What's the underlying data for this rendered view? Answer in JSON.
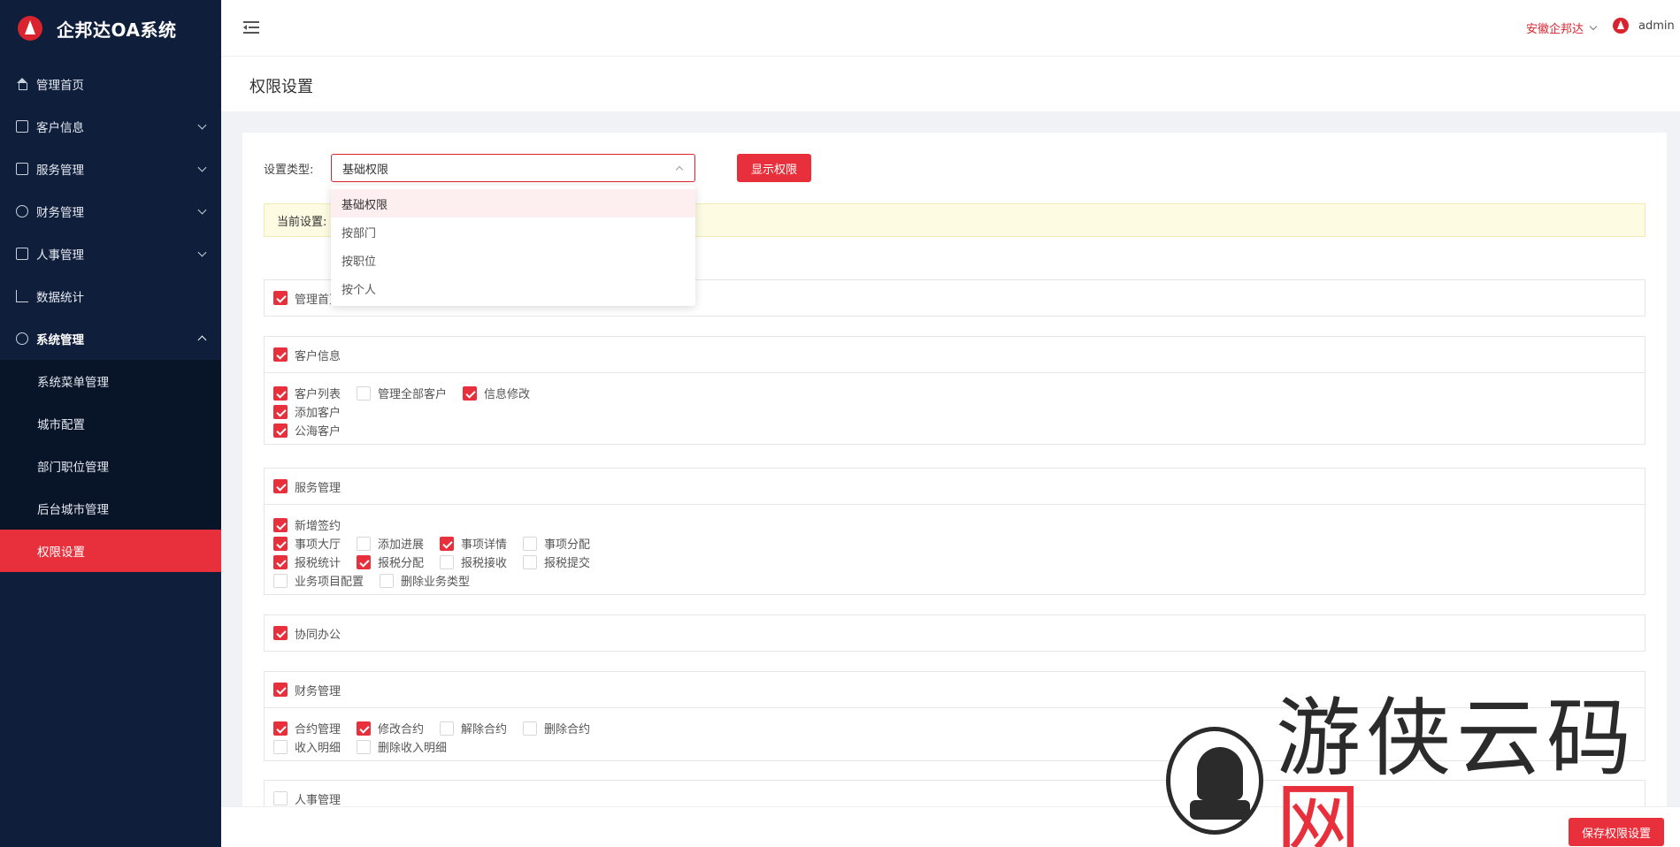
{
  "app": {
    "name": "企邦达OA系统"
  },
  "sidebar": {
    "items": [
      {
        "label": "管理首页",
        "icon": "home-icon",
        "has_children": false
      },
      {
        "label": "客户信息",
        "icon": "id-card-icon",
        "has_children": true
      },
      {
        "label": "服务管理",
        "icon": "document-icon",
        "has_children": true
      },
      {
        "label": "财务管理",
        "icon": "yen-icon",
        "has_children": true
      },
      {
        "label": "人事管理",
        "icon": "person-card-icon",
        "has_children": true
      },
      {
        "label": "数据统计",
        "icon": "chart-icon",
        "has_children": false
      },
      {
        "label": "系统管理",
        "icon": "gear-icon",
        "has_children": true,
        "expanded": true
      }
    ],
    "submenu": [
      {
        "label": "系统菜单管理",
        "active": false
      },
      {
        "label": "城市配置",
        "active": false
      },
      {
        "label": "部门职位管理",
        "active": false
      },
      {
        "label": "后台城市管理",
        "active": false
      },
      {
        "label": "权限设置",
        "active": true
      }
    ]
  },
  "header": {
    "company": "安徽企邦达",
    "username": "admin"
  },
  "page": {
    "title": "权限设置"
  },
  "form": {
    "type_label": "设置类型:",
    "type_value": "基础权限",
    "show_button": "显示权限",
    "options": [
      "基础权限",
      "按部门",
      "按职位",
      "按个人"
    ],
    "selected_option": "基础权限"
  },
  "notice": {
    "text": "当前设置:"
  },
  "groups": [
    {
      "title": "管理首页",
      "checked": true,
      "rows": []
    },
    {
      "title": "客户信息",
      "checked": true,
      "rows": [
        [
          {
            "label": "客户列表",
            "checked": true
          },
          {
            "label": "管理全部客户",
            "checked": false
          },
          {
            "label": "信息修改",
            "checked": true
          }
        ],
        [
          {
            "label": "添加客户",
            "checked": true
          }
        ],
        [
          {
            "label": "公海客户",
            "checked": true
          }
        ]
      ]
    },
    {
      "title": "服务管理",
      "checked": true,
      "rows": [
        [
          {
            "label": "新增签约",
            "checked": true
          }
        ],
        [
          {
            "label": "事项大厅",
            "checked": true
          },
          {
            "label": "添加进展",
            "checked": false
          },
          {
            "label": "事项详情",
            "checked": true
          },
          {
            "label": "事项分配",
            "checked": false
          }
        ],
        [
          {
            "label": "报税统计",
            "checked": true
          },
          {
            "label": "报税分配",
            "checked": true
          },
          {
            "label": "报税接收",
            "checked": false
          },
          {
            "label": "报税提交",
            "checked": false
          }
        ],
        [
          {
            "label": "业务项目配置",
            "checked": false
          },
          {
            "label": "删除业务类型",
            "checked": false
          }
        ]
      ]
    },
    {
      "title": "协同办公",
      "checked": true,
      "rows": []
    },
    {
      "title": "财务管理",
      "checked": true,
      "rows": [
        [
          {
            "label": "合约管理",
            "checked": true
          },
          {
            "label": "修改合约",
            "checked": true
          },
          {
            "label": "解除合约",
            "checked": false
          },
          {
            "label": "删除合约",
            "checked": false
          }
        ],
        [
          {
            "label": "收入明细",
            "checked": false
          },
          {
            "label": "删除收入明细",
            "checked": false
          }
        ]
      ]
    },
    {
      "title": "人事管理",
      "checked": false,
      "rows": []
    }
  ],
  "footer": {
    "save_button": "保存权限设置"
  },
  "watermark": {
    "text_main": "游侠云码",
    "text_red": "网"
  },
  "colors": {
    "accent": "#e8303d",
    "sidebar_bg": "#0f1e3a",
    "notice_bg": "#fdfbe1"
  }
}
